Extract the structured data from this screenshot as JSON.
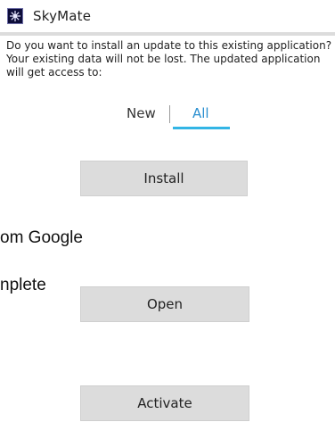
{
  "dialog": {
    "app_name": "SkyMate",
    "app_icon": "skymate-logo-icon",
    "description": "Do you want to install an update to this existing application? Your existing data will not be lost. The updated application will get access to:",
    "tabs": [
      {
        "label": "New",
        "selected": false
      },
      {
        "label": "All",
        "selected": true
      }
    ],
    "install_label": "Install"
  },
  "background": {
    "text_line_1": "om Google",
    "text_line_2": "nplete",
    "open_label": "Open",
    "activate_label": "Activate"
  },
  "colors": {
    "tab_accent": "#33b5e5",
    "button_bg": "#dcdcdc"
  }
}
